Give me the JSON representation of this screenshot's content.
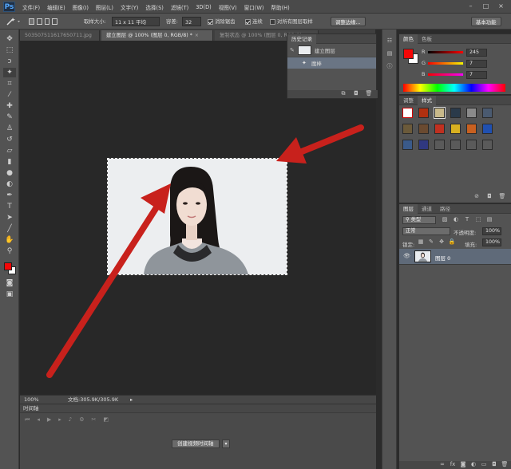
{
  "app": {
    "logo": "Ps",
    "window_controls": [
      "–",
      "□",
      "×"
    ]
  },
  "menu": [
    "文件(F)",
    "编辑(E)",
    "图像(I)",
    "图层(L)",
    "文字(Y)",
    "选择(S)",
    "滤镜(T)",
    "3D(D)",
    "视图(V)",
    "窗口(W)",
    "帮助(H)"
  ],
  "options": {
    "sample_size_label": "取样大小:",
    "sample_size_value": "11 x 11 平均",
    "tolerance_label": "容差:",
    "tolerance_value": "32",
    "anti_alias_label": "消除锯齿",
    "contiguous_label": "连续",
    "sample_all_label": "对所有图层取样",
    "refine_edge_button": "调整边缘...",
    "workspace_button": "基本功能"
  },
  "tabs": [
    {
      "label": "50350751161765071​1.jpg",
      "active": false
    },
    {
      "label": "建立图层 @ 100% (图层 0, RGB/8) *",
      "active": true
    },
    {
      "label": "复制状态 @ 100% (图层 0, RGB/8)",
      "active": false
    }
  ],
  "history": {
    "title": "历史记录",
    "snapshot_label": "建立图层",
    "step_label": "魔棒"
  },
  "status": {
    "zoom": "100%",
    "doc": "文档:305.9K/305.9K"
  },
  "timeline": {
    "title": "时间轴",
    "create_button": "创建视频时间轴"
  },
  "color_panel": {
    "tab_color": "颜色",
    "tab_swatches": "色板",
    "r_label": "R",
    "g_label": "G",
    "b_label": "B",
    "r": "245",
    "g": "7",
    "b": "7",
    "foreground": "#f50707",
    "background": "#ffffff"
  },
  "styles_panel": {
    "tab_adjust": "调整",
    "tab_styles": "样式"
  },
  "layers_panel": {
    "tab_layers": "图层",
    "tab_channels": "通道",
    "tab_paths": "路径",
    "filter_label": "类型",
    "blend_mode": "正常",
    "opacity_label": "不透明度:",
    "opacity_value": "100%",
    "lock_label": "锁定:",
    "fill_label": "填充:",
    "fill_value": "100%",
    "layer_name": "图层 0"
  }
}
